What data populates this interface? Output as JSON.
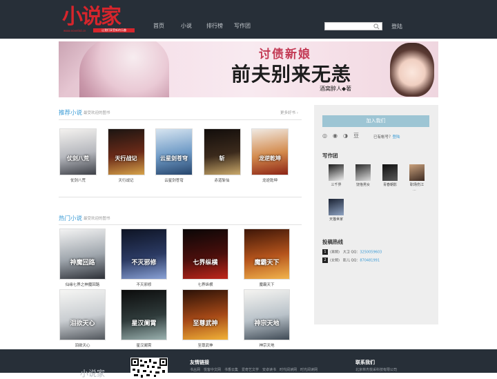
{
  "header": {
    "logo_text": "小说家",
    "logo_url": "www.novelist.cn",
    "logo_tag": "让我们享受新的乐趣",
    "nav": [
      "首页",
      "小说",
      "排行榜",
      "写作团"
    ],
    "search_placeholder": "",
    "login": "登陆"
  },
  "banner": {
    "small_title": "讨债新娘",
    "big_title": "前夫别来无恙",
    "author": "酒窝醉人◆著"
  },
  "recommended": {
    "title": "推荐小说",
    "subtitle": "最受欢迎的图书",
    "more": "更多好书 ›",
    "books": [
      {
        "name": "仗剑八荒",
        "cover_text": "仗剑八荒",
        "colors": [
          "#f4f2ef",
          "#b5b7bd",
          "#3c3f46"
        ]
      },
      {
        "name": "天行战记",
        "cover_text": "天行战记",
        "colors": [
          "#1b1512",
          "#6b2a18",
          "#d7a34a"
        ]
      },
      {
        "name": "云星剑苍穹",
        "cover_text": "云星剑苍穹",
        "colors": [
          "#d6e4f0",
          "#6e9ac6",
          "#26456c"
        ]
      },
      {
        "name": "赤道斩仙",
        "cover_text": "斩",
        "colors": [
          "#120d0b",
          "#3b2a1c",
          "#c9a86a"
        ]
      },
      {
        "name": "龙逆乾坤",
        "cover_text": "龙逆乾坤",
        "colors": [
          "#f0e9e2",
          "#d38a4c",
          "#8c2415"
        ]
      }
    ]
  },
  "hot": {
    "title": "热门小说",
    "subtitle": "最受欢迎的图书",
    "books": [
      {
        "name": "仙缘七界之神魔回路",
        "cover_text": "神魔回路",
        "colors": [
          "#f3f3f3",
          "#9fa6ad",
          "#2c2f36"
        ]
      },
      {
        "name": "不灭邪修",
        "cover_text": "不灭邪修",
        "colors": [
          "#0e1424",
          "#2b3a63",
          "#8aa2d6"
        ]
      },
      {
        "name": "七界纵横",
        "cover_text": "七界纵横",
        "colors": [
          "#0a0707",
          "#4a0f0c",
          "#c0261b"
        ]
      },
      {
        "name": "魔霸天下",
        "cover_text": "魔霸天下",
        "colors": [
          "#3e1608",
          "#b5541c",
          "#f2b44d"
        ]
      },
      {
        "name": "泪欲天心",
        "cover_text": "泪欲天心",
        "colors": [
          "#f6f6f4",
          "#c9cdd1",
          "#51565c"
        ]
      },
      {
        "name": "星汉阑霄",
        "cover_text": "星汉阑霄",
        "colors": [
          "#0c0c0c",
          "#2f3b3b",
          "#9bb2b0"
        ]
      },
      {
        "name": "至尊武神",
        "cover_text": "至尊武神",
        "colors": [
          "#2b1107",
          "#a64917",
          "#f1b238"
        ]
      },
      {
        "name": "神宗天地",
        "cover_text": "神宗天地",
        "colors": [
          "#f5f4f1",
          "#b9c2c9",
          "#3f4a55"
        ]
      }
    ]
  },
  "sidebar": {
    "join": "加入我们",
    "share_icons": [
      "weibo-icon",
      "tencent-weibo-icon",
      "qzone-icon",
      "douban-icon"
    ],
    "share_glyphs": [
      "◎",
      "◉",
      "◑",
      "豆"
    ],
    "account_prompt": "已有帐号？",
    "account_login": "登陆",
    "writers_title": "写作团",
    "writers": [
      {
        "name": "三千界",
        "colors": [
          "#1a1a1a",
          "#f2f2f2"
        ]
      },
      {
        "name": "饶恪男女",
        "colors": [
          "#2a2a2a",
          "#dcdcdc"
        ]
      },
      {
        "name": "青春朝影",
        "colors": [
          "#0f0f0f",
          "#5a5a5a"
        ]
      },
      {
        "name": "职场伤江",
        "colors": [
          "#caa27d",
          "#3c2a22"
        ]
      },
      {
        "name": "天猫世家",
        "colors": [
          "#1a2233",
          "#8fa3c2"
        ]
      }
    ],
    "writer_extra": "...",
    "hotline_title": "投稿热线",
    "hotlines": [
      {
        "num": "1",
        "label": "(男频)　大卫 QQ：",
        "qq": "3250059603"
      },
      {
        "num": "2",
        "label": "(女频)　影儿 QQ：",
        "qq": "870481991"
      }
    ]
  },
  "footer": {
    "logo": "小说家",
    "links_title": "友情链接",
    "links": "书丛网　悦客中文网　书香云集　爱奇艺文学　安卓读书　时代阅读网　时光阅读网",
    "contact_title": "联系我们",
    "company": "北京林杰悦采科技有限公司"
  }
}
